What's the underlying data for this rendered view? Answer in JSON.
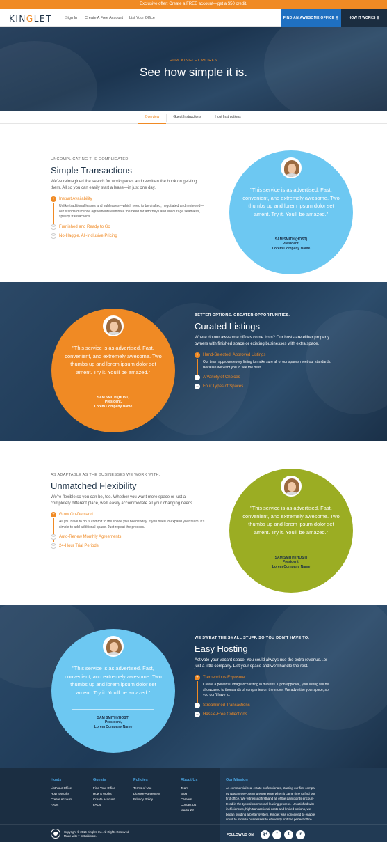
{
  "promo": {
    "text": "Exclusive offer: Create a FREE account—get a $50 credit."
  },
  "nav": {
    "logo_part1": "KIN",
    "logo_accent": "G",
    "logo_part2": "LET",
    "links": [
      "Sign In",
      "Create A Free Account",
      "List Your Office"
    ],
    "cta": "FIND AN AWESOME OFFICE",
    "how": "HOW IT WORKS"
  },
  "hero": {
    "kicker": "HOW KINGLET WORKS",
    "title": "See how simple it is."
  },
  "tabs": [
    "Overview",
    "Guest Instructions",
    "Host Instructions"
  ],
  "testimonial": {
    "quote": "\"This service is as advertised. Fast, convenient, and extremely awesome. Two thumbs up and lorem ipsum dolor set ament. Try it. You'll be amazed.\"",
    "name": "SAM SMITH (HOST)",
    "role1": "President,",
    "role2": "Lorem Company Name"
  },
  "sections": {
    "s1": {
      "kicker": "UNCOMPLICATING THE COMPLICATED.",
      "title": "Simple Transactions",
      "lead": "We've reimagined the search for workspaces and rewritten the book on get-ting them. All so you can easily start a lease—in just one day.",
      "items": [
        {
          "label": "Instant Availability",
          "body": "Unlike traditional leases and subleases—which need to be drafted, negotiated and reviewed—our standard license agreements eliminate the need for attorneys and encourage seamless, speedy transactions."
        },
        {
          "label": "Furnished and Ready to Go"
        },
        {
          "label": "No-Haggle, All-Inclusive Pricing"
        }
      ]
    },
    "s2": {
      "kicker": "BETTER OPTIONS. GREATER OPPORTUNITIES.",
      "title": "Curated Listings",
      "lead": "Where do our awesome offices come from? Our hosts are either property owners with finished space or existing businesses with extra space.",
      "items": [
        {
          "label": "Hand-Selected, Approved Listings",
          "body": "Our team approves every listing to make sure all of our spaces meet our standards. Because we want you to see the best."
        },
        {
          "label": "A Variety of Choices"
        },
        {
          "label": "Four Types of Spaces"
        }
      ]
    },
    "s3": {
      "kicker": "AS ADAPTABLE AS THE BUSINESSES WE WORK WITH.",
      "title": "Unmatched Flexibility",
      "lead": "We're flexible so you can be, too. Whether you want more space or just a completely different place, we'll easily accommodate all your changing needs.",
      "items": [
        {
          "label": "Grow On-Demand",
          "body": "All you have to do is commit to the space you need today. If you need to expand your team, it's simple to add additional space. Just repeat the process."
        },
        {
          "label": "Auto-Renew Monthly Agreements"
        },
        {
          "label": "24-Hour Trial Periods"
        }
      ]
    },
    "s4": {
      "kicker": "WE SWEAT THE SMALL STUFF, SO YOU DON'T HAVE TO.",
      "title": "Easy Hosting",
      "lead": "Activate your vacant space. You could always use the extra revenue...or just a little company. List your space and we'll handle the rest.",
      "items": [
        {
          "label": "Tremendous Exposure",
          "body": "Create a powerful, image-rich listing in minutes. Upon approval, your listing will be showcased to thousands of companies on the move. We advertise your space, so you don't have to."
        },
        {
          "label": "Streamlined Transactions"
        },
        {
          "label": "Hassle-Free Collections"
        }
      ]
    }
  },
  "colors": {
    "orange": "#f08a24",
    "sky": "#6dc8f2",
    "olive": "#9bad23",
    "navy": "#1b2e42"
  },
  "footer": {
    "hosts": {
      "title": "Hosts",
      "items": [
        "List Your Office",
        "How It Works",
        "Create Account",
        "FAQs"
      ]
    },
    "guests": {
      "title": "Guests",
      "items": [
        "Find Your Office",
        "How It Works",
        "Create Account",
        "FAQs"
      ]
    },
    "policies": {
      "title": "Policies",
      "items": [
        "Terms of Use",
        "License Agreement",
        "Privacy Policy"
      ]
    },
    "about": {
      "title": "About Us",
      "items": [
        "Team",
        "Blog",
        "Careers",
        "Contact Us",
        "Media Kit"
      ]
    },
    "mission": {
      "title": "Our Mission",
      "lines": [
        "As commercial real estate professionals, starting our first compa-",
        "ny was an eye-opening experience when it came time to find our",
        "first office. We witnessed firsthand all of the pain points encoun-",
        "tered in the typical commercial leasing process. Unsatisfied with",
        "inefficiencies, high transactional costs and limited options, we",
        "began building a better system. Kinglet was conceived to enable",
        "small to midsize businesses to efficiently find the perfect office."
      ]
    },
    "copyright": "Copyright © 2016 Kinglet, Inc. All Rights Reserved",
    "made_with": "Made with ♥ in Baltimore.",
    "follow": "FOLLOW US ON",
    "social": [
      "g+",
      "f",
      "t",
      "in"
    ]
  }
}
